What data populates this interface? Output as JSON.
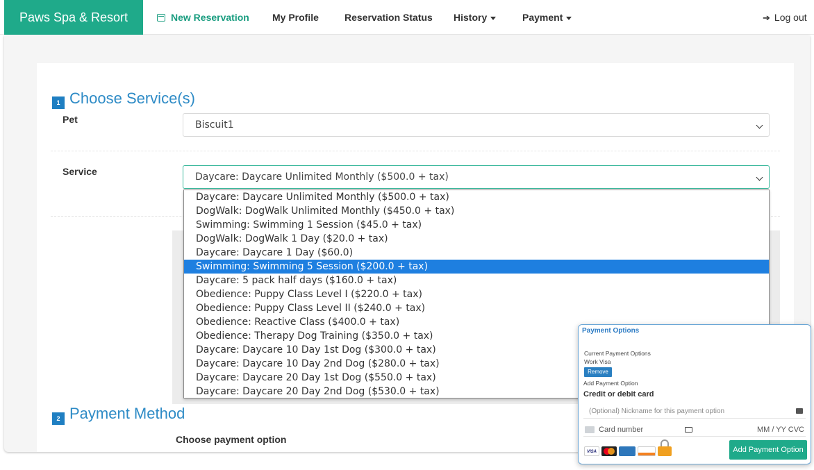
{
  "navbar": {
    "brand": "Paws Spa & Resort",
    "items": [
      {
        "label": "New Reservation",
        "active": true
      },
      {
        "label": "My Profile"
      },
      {
        "label": "Reservation Status"
      },
      {
        "label": "History",
        "dropdown": true
      },
      {
        "label": "Payment",
        "dropdown": true
      }
    ],
    "logout": "Log out"
  },
  "sections": {
    "choose_services": {
      "number": "1",
      "title": "Choose Service(s)"
    },
    "payment_method": {
      "number": "2",
      "title": "Payment Method",
      "subheading": "Choose payment option"
    }
  },
  "form": {
    "pet_label": "Pet",
    "pet_value": "Biscuit1",
    "service_label": "Service",
    "service_value": "Daycare: Daycare Unlimited Monthly ($500.0 + tax)"
  },
  "service_options": [
    "Daycare: Daycare Unlimited Monthly ($500.0 + tax)",
    "DogWalk: DogWalk Unlimited Monthly ($450.0 + tax)",
    "Swimming: Swimming 1 Session ($45.0 + tax)",
    "DogWalk: DogWalk 1 Day ($20.0 + tax)",
    "Daycare: Daycare 1 Day ($60.0)",
    "Swimming: Swimming 5 Session ($200.0 + tax)",
    "Daycare: 5 pack half days ($160.0 + tax)",
    "Obedience: Puppy Class Level I ($220.0 + tax)",
    "Obedience: Puppy Class Level II ($240.0 + tax)",
    "Obedience: Reactive Class ($400.0 + tax)",
    "Obedience: Therapy Dog Training ($350.0 + tax)",
    "Daycare: Daycare 10 Day 1st Dog ($300.0 + tax)",
    "Daycare: Daycare 10 Day 2nd Dog ($280.0 + tax)",
    "Daycare: Daycare 20 Day 1st Dog ($550.0 + tax)",
    "Daycare: Daycare 20 Day 2nd Dog ($530.0 + tax)"
  ],
  "highlighted_option": "Swimming: Swimming 5 Session ($200.0 + tax)",
  "payment_popup": {
    "title": "Payment Options",
    "current_label": "Current Payment Options",
    "current_item": "Work Visa",
    "remove_label": "Remove",
    "add_label": "Add Payment Option",
    "card_heading": "Credit or debit card",
    "nickname_placeholder": "(Optional) Nickname for this payment option",
    "card_number_placeholder": "Card number",
    "expiry_cvc_placeholder": "MM / YY  CVC",
    "card_brands": [
      "VISA",
      "MC",
      "AMEX",
      "DISCOVER"
    ],
    "add_button": "Add Payment Option"
  },
  "colors": {
    "brand": "#1faa8a",
    "accent": "#2e8bc6",
    "highlight": "#1e7fe0",
    "badge": "#1f7fc2"
  }
}
